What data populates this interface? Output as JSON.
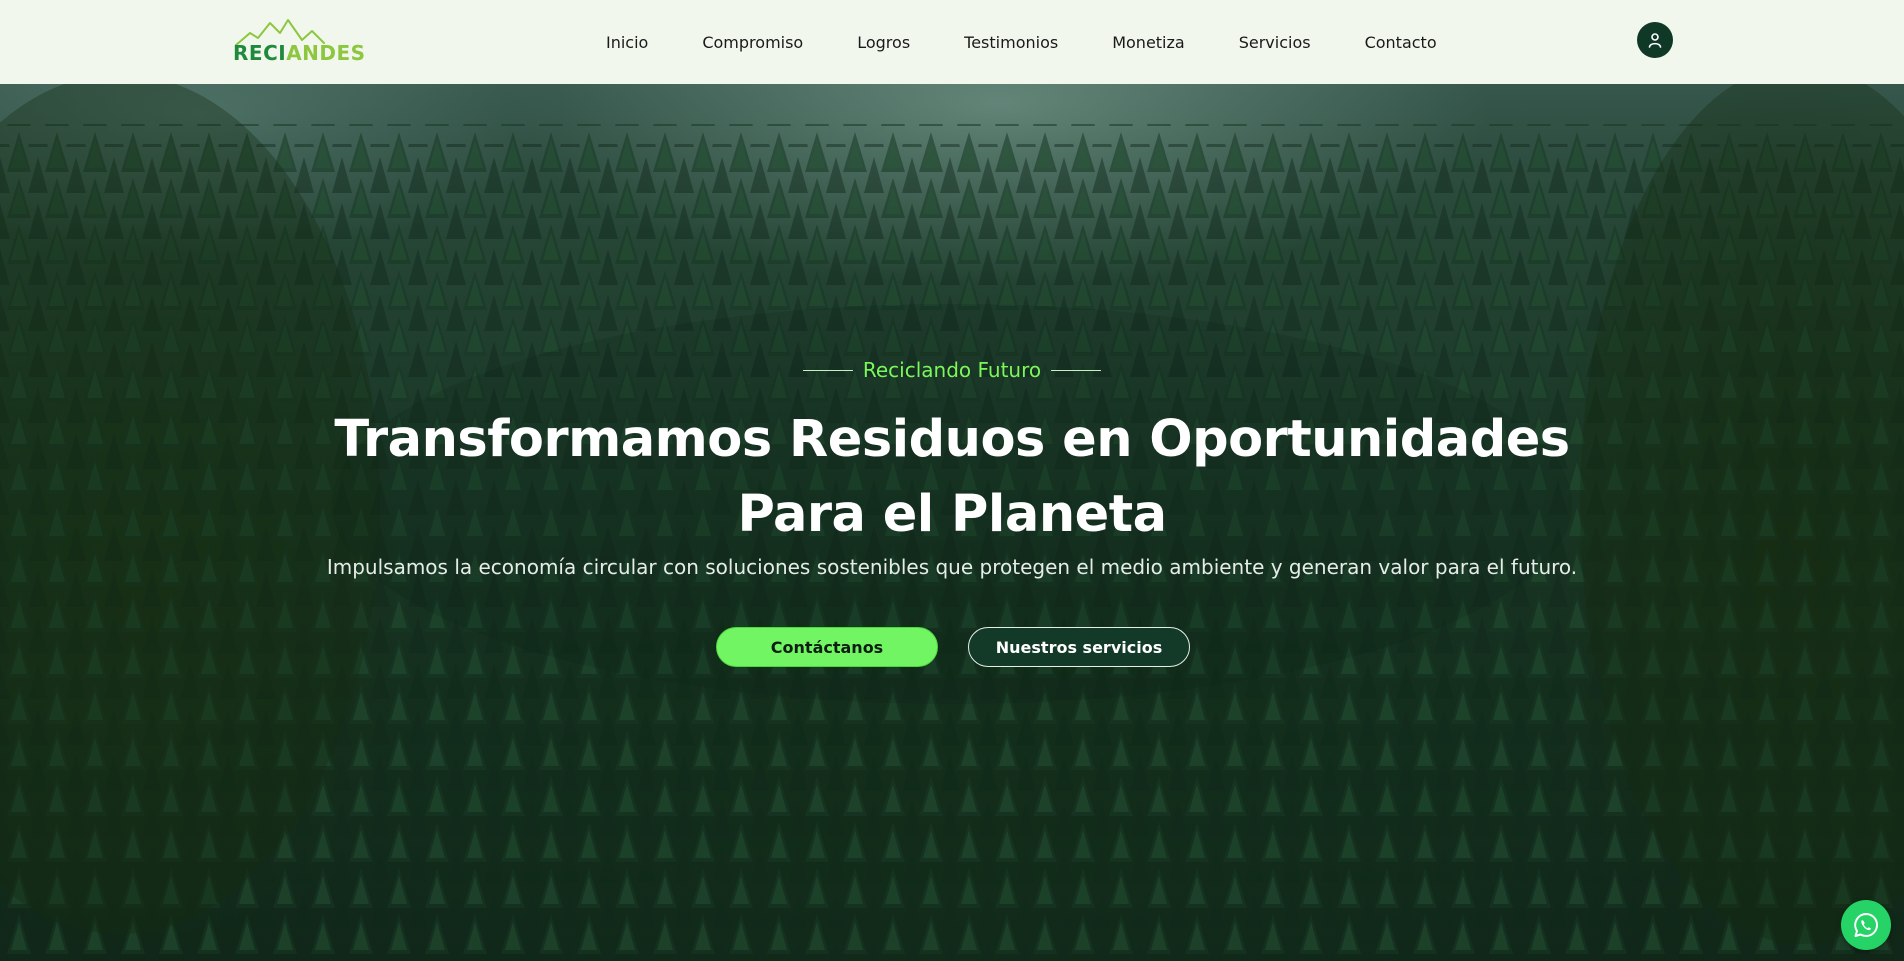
{
  "brand": {
    "logo_text_1": "RECI",
    "logo_text_2": "ANDES",
    "logo_icon": "mountain-icon",
    "colors": {
      "primary": "#1f8a3b",
      "accent": "#8dc63f"
    }
  },
  "nav": {
    "items": [
      {
        "label": "Inicio"
      },
      {
        "label": "Compromiso"
      },
      {
        "label": "Logros"
      },
      {
        "label": "Testimonios"
      },
      {
        "label": "Monetiza"
      },
      {
        "label": "Servicios"
      },
      {
        "label": "Contacto"
      }
    ],
    "user_icon": "user-icon"
  },
  "hero": {
    "kicker": "Reciclando Futuro",
    "title_line_1": "Transformamos Residuos en Oportunidades",
    "title_line_2": "Para el Planeta",
    "subtitle": "Impulsamos la economía circular con soluciones sostenibles que protegen el medio ambiente y generan valor para el futuro.",
    "primary_cta": "Contáctanos",
    "secondary_cta": "Nuestros servicios",
    "colors": {
      "kicker": "#7cf75a",
      "primary_cta_bg": "#72f562",
      "secondary_cta_bg": "#133a29"
    }
  },
  "floating": {
    "whatsapp_icon": "whatsapp-icon",
    "color": "#25d366"
  }
}
